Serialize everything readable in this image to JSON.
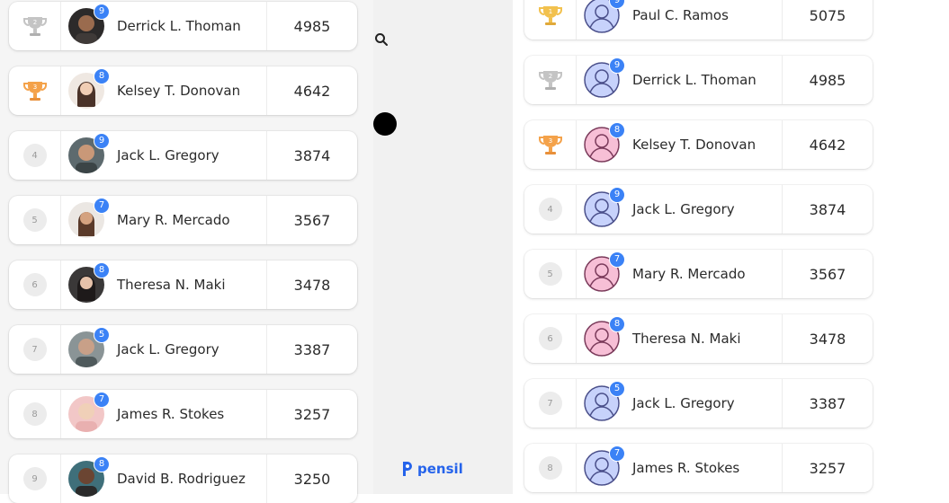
{
  "colors": {
    "gold": "#f2c14e",
    "silver": "#b9b9b9",
    "bronze": "#f4a24a",
    "badge": "#3b82f6",
    "brand": "#2563eb"
  },
  "brand": {
    "name": "pensil",
    "logo_icon": "pensil-logo-icon"
  },
  "tools": {
    "search_icon": "search-icon"
  },
  "left_list": [
    {
      "rank": "2",
      "medal": "silver",
      "level": "9",
      "name": "Derrick L. Thoman",
      "score": "4985"
    },
    {
      "rank": "3",
      "medal": "bronze",
      "level": "8",
      "name": "Kelsey T. Donovan",
      "score": "4642"
    },
    {
      "rank": "4",
      "medal": "",
      "level": "9",
      "name": "Jack L. Gregory",
      "score": "3874"
    },
    {
      "rank": "5",
      "medal": "",
      "level": "7",
      "name": "Mary R. Mercado",
      "score": "3567"
    },
    {
      "rank": "6",
      "medal": "",
      "level": "8",
      "name": "Theresa N. Maki",
      "score": "3478"
    },
    {
      "rank": "7",
      "medal": "",
      "level": "5",
      "name": "Jack L. Gregory",
      "score": "3387"
    },
    {
      "rank": "8",
      "medal": "",
      "level": "7",
      "name": "James R. Stokes",
      "score": "3257"
    },
    {
      "rank": "9",
      "medal": "",
      "level": "8",
      "name": "David B. Rodriguez",
      "score": "3250"
    }
  ],
  "right_list": [
    {
      "rank": "1",
      "medal": "gold",
      "level": "9",
      "name": "Paul C. Ramos",
      "score": "5075"
    },
    {
      "rank": "2",
      "medal": "silver",
      "level": "9",
      "name": "Derrick L. Thoman",
      "score": "4985"
    },
    {
      "rank": "3",
      "medal": "bronze",
      "level": "8",
      "name": "Kelsey T. Donovan",
      "score": "4642"
    },
    {
      "rank": "4",
      "medal": "",
      "level": "9",
      "name": "Jack L. Gregory",
      "score": "3874"
    },
    {
      "rank": "5",
      "medal": "",
      "level": "7",
      "name": "Mary R. Mercado",
      "score": "3567"
    },
    {
      "rank": "6",
      "medal": "",
      "level": "8",
      "name": "Theresa N. Maki",
      "score": "3478"
    },
    {
      "rank": "7",
      "medal": "",
      "level": "5",
      "name": "Jack L. Gregory",
      "score": "3387"
    },
    {
      "rank": "8",
      "medal": "",
      "level": "7",
      "name": "James R. Stokes",
      "score": "3257"
    }
  ]
}
